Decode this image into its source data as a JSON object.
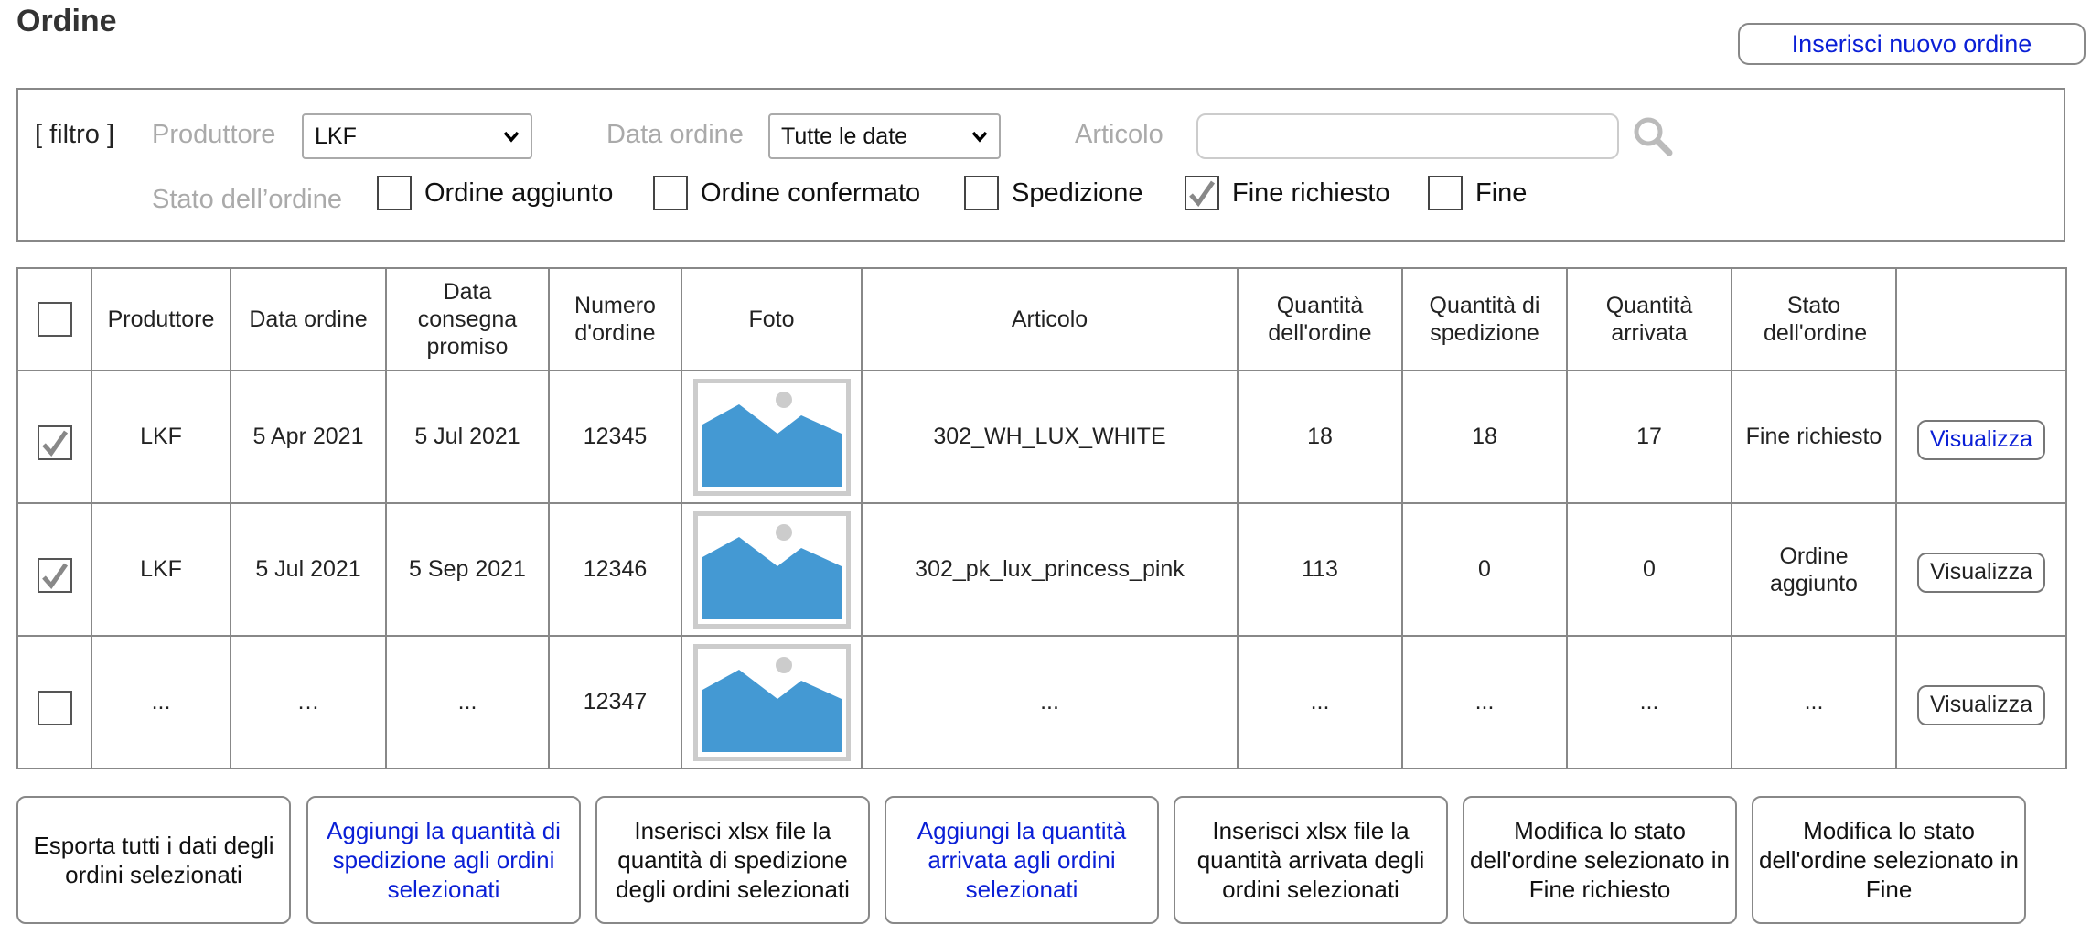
{
  "page": {
    "title": "Ordine"
  },
  "header": {
    "new_order_label": "Inserisci nuovo ordine"
  },
  "filter": {
    "tag": "[ filtro ]",
    "producer_label": "Produttore",
    "producer_value": "LKF",
    "date_label": "Data ordine",
    "date_value": "Tutte le date",
    "article_label": "Articolo",
    "article_value": "",
    "status_label": "Stato dell’ordine",
    "statuses": [
      {
        "label": "Ordine aggiunto",
        "checked": false
      },
      {
        "label": "Ordine confermato",
        "checked": false
      },
      {
        "label": "Spedizione",
        "checked": false
      },
      {
        "label": "Fine richiesto",
        "checked": true
      },
      {
        "label": "Fine",
        "checked": false
      }
    ]
  },
  "table": {
    "headers": [
      "",
      "Produttore",
      "Data ordine",
      "Data consegna promiso",
      "Numero d'ordine",
      "Foto",
      "Articolo",
      "Quantità dell'ordine",
      "Quantità di spedizione",
      "Quantità arrivata",
      "Stato dell'ordine",
      ""
    ],
    "rows": [
      {
        "checked": true,
        "producer": "LKF",
        "order_date": "5 Apr 2021",
        "delivery_date": "5 Jul 2021",
        "order_number": "12345",
        "article": "302_WH_LUX_WHITE",
        "qty_order": "18",
        "qty_shipped": "18",
        "qty_arrived": "17",
        "status": "Fine richiesto",
        "action": "Visualizza"
      },
      {
        "checked": true,
        "producer": "LKF",
        "order_date": "5 Jul 2021",
        "delivery_date": "5 Sep 2021",
        "order_number": "12346",
        "article": "302_pk_lux_princess_pink",
        "qty_order": "113",
        "qty_shipped": "0",
        "qty_arrived": "0",
        "status": "Ordine aggiunto",
        "action": "Visualizza"
      },
      {
        "checked": false,
        "producer": "...",
        "order_date": "…",
        "delivery_date": "...",
        "order_number": "12347",
        "article": "...",
        "qty_order": "...",
        "qty_shipped": "...",
        "qty_arrived": "...",
        "status": "...",
        "action": "Visualizza"
      }
    ]
  },
  "actions": [
    "Esporta tutti i dati degli ordini selezionati",
    "Aggiungi la quantità di spedizione agli ordini selezionati",
    "Inserisci xlsx file la quantità di spedizione degli ordini selezionati",
    "Aggiungi la quantità arrivata agli ordini selezionati",
    "Inserisci xlsx file la quantità arrivata degli ordini selezionati",
    "Modifica lo stato dell'ordine selezionato in Fine richiesto",
    "Modifica lo stato dell'ordine selezionato in Fine"
  ],
  "colors": {
    "link_blue": "#0a1fd6",
    "image_blue": "#4499d3",
    "image_frame": "#cccccc"
  }
}
